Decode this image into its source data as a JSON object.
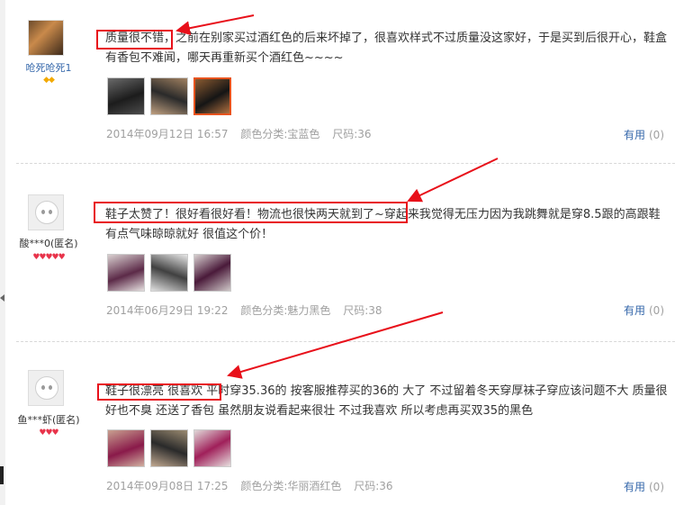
{
  "colors": {
    "accent_red": "#e8101a",
    "link_blue": "#3366aa",
    "meta_gray": "#a0a0a0"
  },
  "reviews": [
    {
      "username": "呛死呛死1",
      "badge": "◆◆",
      "avatar": "user-photo",
      "text": "质量很不错，之前在别家买过酒红色的后来坏掉了，很喜欢样式不过质量没这家好，于是买到后很开心，鞋盒有香包不难闻，哪天再重新买个酒红色~~~~",
      "date": "2014年09月12日 16:57",
      "color_label": "颜色分类:宝蓝色",
      "size_label": "尺码:36",
      "helpful_label": "有用",
      "helpful_count": "(0)"
    },
    {
      "username": "酸***0(匿名)",
      "badge": "♥♥♥♥♥",
      "avatar": "default-avatar",
      "text": "鞋子太赞了！很好看很好看！物流也很快两天就到了~穿起来我觉得无压力因为我跳舞就是穿8.5跟的高跟鞋 有点气味晾晾就好 很值这个价！",
      "date": "2014年06月29日 19:22",
      "color_label": "颜色分类:魅力黑色",
      "size_label": "尺码:38",
      "helpful_label": "有用",
      "helpful_count": "(0)"
    },
    {
      "username": "鱼***虾(匿名)",
      "badge": "♥♥♥",
      "avatar": "default-avatar",
      "text": "鞋子很漂亮 很喜欢 平时穿35.36的 按客服推荐买的36的 大了 不过留着冬天穿厚袜子穿应该问题不大 质量很好也不臭 还送了香包 虽然朋友说看起来很壮 不过我喜欢 所以考虑再买双35的黑色",
      "date": "2014年09月08日 17:25",
      "color_label": "颜色分类:华丽酒红色",
      "size_label": "尺码:36",
      "helpful_label": "有用",
      "helpful_count": "(0)"
    }
  ]
}
